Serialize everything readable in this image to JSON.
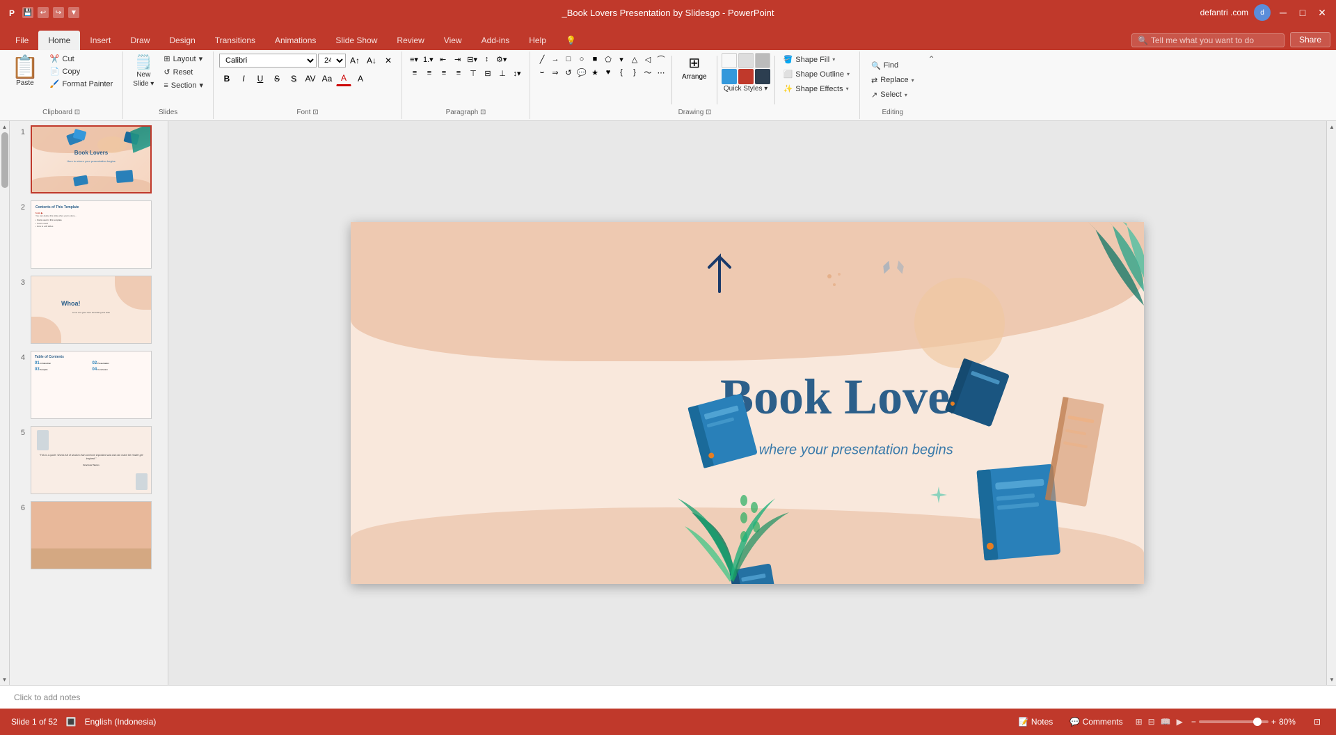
{
  "titleBar": {
    "filename": "_Book Lovers Presentation by Slidesgo - PowerPoint",
    "user": "defantri .com",
    "controls": {
      "minimize": "─",
      "maximize": "□",
      "close": "✕"
    }
  },
  "quickAccessToolbar": {
    "save": "💾",
    "undo": "↩",
    "redo": "↪"
  },
  "tabs": [
    {
      "id": "file",
      "label": "File"
    },
    {
      "id": "home",
      "label": "Home",
      "active": true
    },
    {
      "id": "insert",
      "label": "Insert"
    },
    {
      "id": "draw",
      "label": "Draw"
    },
    {
      "id": "design",
      "label": "Design"
    },
    {
      "id": "transitions",
      "label": "Transitions"
    },
    {
      "id": "animations",
      "label": "Animations"
    },
    {
      "id": "slideshow",
      "label": "Slide Show"
    },
    {
      "id": "review",
      "label": "Review"
    },
    {
      "id": "view",
      "label": "View"
    },
    {
      "id": "addins",
      "label": "Add-ins"
    },
    {
      "id": "help",
      "label": "Help"
    }
  ],
  "searchBox": {
    "placeholder": "Tell me what you want to do"
  },
  "shareBtn": "Share",
  "ribbon": {
    "clipboard": {
      "label": "Clipboard",
      "paste": "Paste",
      "cut": "Cut",
      "copy": "Copy",
      "formatPainter": "Format Painter"
    },
    "slides": {
      "label": "Slides",
      "newSlide": "New\nSlide",
      "layout": "Layout",
      "reset": "Reset",
      "section": "Section"
    },
    "font": {
      "label": "Font",
      "fontName": "Calibri",
      "fontSize": "24",
      "bold": "B",
      "italic": "I",
      "underline": "U",
      "strikethrough": "S",
      "shadow": "S",
      "changCase": "Aa",
      "fontColor": "A",
      "clearFormat": "✕"
    },
    "paragraph": {
      "label": "Paragraph"
    },
    "drawing": {
      "label": "Drawing",
      "arrange": "Arrange",
      "quickStyles": "Quick\nStyles",
      "shapeFill": "Shape Fill",
      "shapeOutline": "Shape Outline",
      "shapeEffects": "Shape Effects"
    },
    "editing": {
      "label": "Editing",
      "find": "Find",
      "replace": "Replace",
      "select": "Select"
    }
  },
  "slidePanel": {
    "slides": [
      {
        "number": 1,
        "type": "cover",
        "active": true
      },
      {
        "number": 2,
        "type": "contents"
      },
      {
        "number": 3,
        "type": "whoa"
      },
      {
        "number": 4,
        "type": "table"
      },
      {
        "number": 5,
        "type": "quote"
      },
      {
        "number": 6,
        "type": "color"
      }
    ]
  },
  "mainSlide": {
    "title": "Book Lovers",
    "subtitle": "Here is where your presentation begins"
  },
  "statusBar": {
    "slideInfo": "Slide 1 of 52",
    "language": "English (Indonesia)",
    "notes": "Notes",
    "comments": "Comments",
    "zoom": "80%"
  },
  "notesBar": {
    "placeholder": "Click to add notes"
  }
}
